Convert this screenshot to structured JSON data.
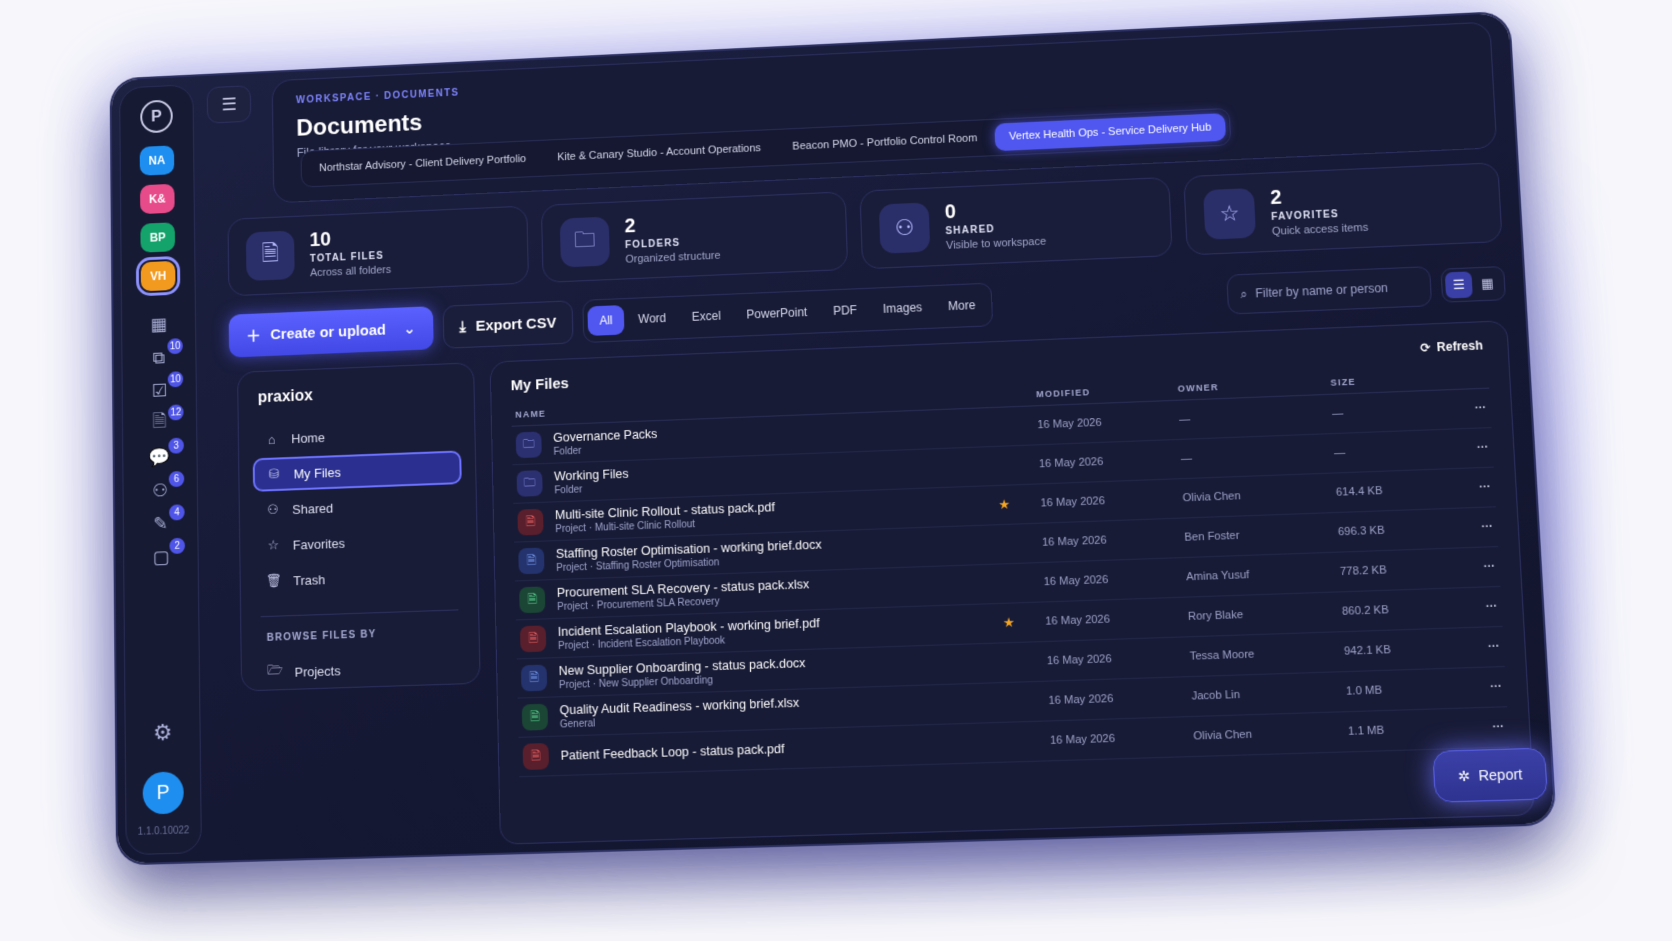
{
  "app": {
    "logo_letter": "P",
    "version": "1.1.0.10022",
    "user_initial": "P"
  },
  "workspaces": [
    {
      "initials": "NA",
      "color": "#1e8ff0"
    },
    {
      "initials": "K&",
      "color": "#e84b8a"
    },
    {
      "initials": "BP",
      "color": "#14a36b"
    },
    {
      "initials": "VH",
      "color": "#f29a1f",
      "active": true
    }
  ],
  "rail_counts": [
    "10",
    "10",
    "12",
    "3",
    "6",
    "4",
    "2"
  ],
  "header": {
    "crumb_workspace": "WORKSPACE",
    "crumb_section": "DOCUMENTS",
    "title": "Documents",
    "subtitle": "File library for your workspace",
    "tabs": [
      {
        "label": "Northstar Advisory - Client Delivery Portfolio"
      },
      {
        "label": "Kite & Canary Studio - Account Operations"
      },
      {
        "label": "Beacon PMO - Portfolio Control Room"
      },
      {
        "label": "Vertex Health Ops - Service Delivery Hub",
        "active": true
      }
    ]
  },
  "stats": [
    {
      "value": "10",
      "label": "TOTAL FILES",
      "sub": "Across all folders",
      "icon": "file-icon"
    },
    {
      "value": "2",
      "label": "FOLDERS",
      "sub": "Organized structure",
      "icon": "folder-icon"
    },
    {
      "value": "0",
      "label": "SHARED",
      "sub": "Visible to workspace",
      "icon": "users-icon"
    },
    {
      "value": "2",
      "label": "FAVORITES",
      "sub": "Quick access items",
      "icon": "star-icon"
    }
  ],
  "toolbar": {
    "create_label": "Create or upload",
    "export_label": "Export CSV",
    "filters": [
      "All",
      "Word",
      "Excel",
      "PowerPoint",
      "PDF",
      "Images",
      "More"
    ],
    "active_filter": "All",
    "search_placeholder": "Filter by name or person"
  },
  "sidenav": {
    "org": "praxiox",
    "items": [
      {
        "label": "Home",
        "icon": "home-icon"
      },
      {
        "label": "My Files",
        "icon": "drive-icon",
        "active": true
      },
      {
        "label": "Shared",
        "icon": "users-icon"
      },
      {
        "label": "Favorites",
        "icon": "star-icon"
      },
      {
        "label": "Trash",
        "icon": "trash-icon"
      }
    ],
    "section_title": "BROWSE FILES BY",
    "browse": [
      {
        "label": "Projects",
        "icon": "folder-open-icon"
      }
    ]
  },
  "files": {
    "title": "My Files",
    "refresh_label": "Refresh",
    "columns": {
      "name": "NAME",
      "modified": "MODIFIED",
      "owner": "OWNER",
      "size": "SIZE"
    },
    "rows": [
      {
        "name": "Governance Packs",
        "sub": "Folder",
        "type": "folder",
        "modified": "16 May 2026",
        "owner": "—",
        "size": "—",
        "star": false
      },
      {
        "name": "Working Files",
        "sub": "Folder",
        "type": "folder",
        "modified": "16 May 2026",
        "owner": "—",
        "size": "—",
        "star": false
      },
      {
        "name": "Multi-site Clinic Rollout - status pack.pdf",
        "sub": "Project · Multi-site Clinic Rollout",
        "type": "pdf",
        "modified": "16 May 2026",
        "owner": "Olivia Chen",
        "size": "614.4 KB",
        "star": true
      },
      {
        "name": "Staffing Roster Optimisation - working brief.docx",
        "sub": "Project · Staffing Roster Optimisation",
        "type": "docx",
        "modified": "16 May 2026",
        "owner": "Ben Foster",
        "size": "696.3 KB",
        "star": false
      },
      {
        "name": "Procurement SLA Recovery - status pack.xlsx",
        "sub": "Project · Procurement SLA Recovery",
        "type": "xlsx",
        "modified": "16 May 2026",
        "owner": "Amina Yusuf",
        "size": "778.2 KB",
        "star": false
      },
      {
        "name": "Incident Escalation Playbook - working brief.pdf",
        "sub": "Project · Incident Escalation Playbook",
        "type": "pdf",
        "modified": "16 May 2026",
        "owner": "Rory Blake",
        "size": "860.2 KB",
        "star": true
      },
      {
        "name": "New Supplier Onboarding - status pack.docx",
        "sub": "Project · New Supplier Onboarding",
        "type": "docx",
        "modified": "16 May 2026",
        "owner": "Tessa Moore",
        "size": "942.1 KB",
        "star": false
      },
      {
        "name": "Quality Audit Readiness - working brief.xlsx",
        "sub": "General",
        "type": "xlsx",
        "modified": "16 May 2026",
        "owner": "Jacob Lin",
        "size": "1.0 MB",
        "star": false
      },
      {
        "name": "Patient Feedback Loop - status pack.pdf",
        "sub": "",
        "type": "pdf",
        "modified": "16 May 2026",
        "owner": "Olivia Chen",
        "size": "1.1 MB",
        "star": false
      }
    ]
  },
  "report_label": "Report"
}
